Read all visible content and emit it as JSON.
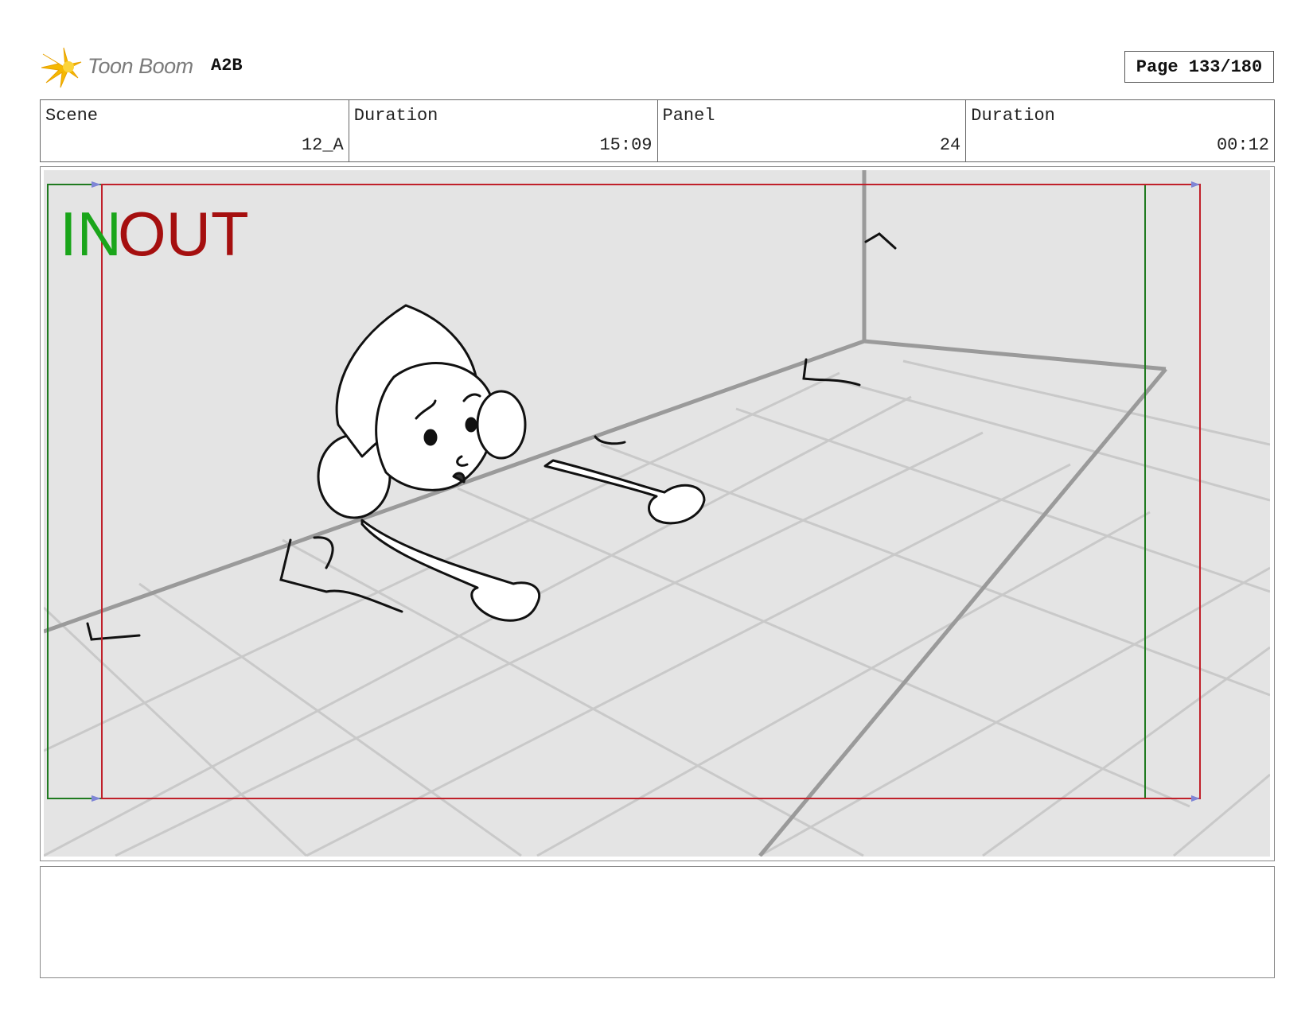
{
  "header": {
    "logo_text": "Toon Boom",
    "project_code": "A2B",
    "page_label": "Page 133/180"
  },
  "info": {
    "scene_label": "Scene",
    "scene_value": "12_A",
    "duration1_label": "Duration",
    "duration1_value": "15:09",
    "panel_label": "Panel",
    "panel_value": "24",
    "duration2_label": "Duration",
    "duration2_value": "00:12"
  },
  "panel": {
    "in_marker": "IN",
    "out_marker": "OUT",
    "colors": {
      "in_frame": "#1f7a1f",
      "out_frame": "#c0202a",
      "background": "#e4e4e4",
      "grid": "#c9c9c9",
      "wall_edge": "#9a9a9a"
    }
  },
  "notes": {
    "text": ""
  }
}
